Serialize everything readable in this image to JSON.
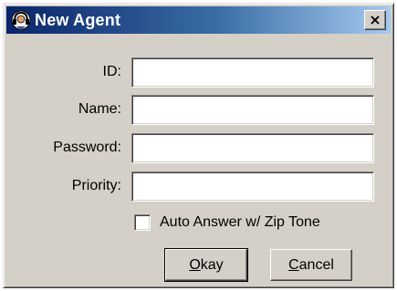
{
  "window": {
    "title": "New Agent",
    "close_glyph": "×",
    "icon": "agent-headset-icon"
  },
  "form": {
    "fields": [
      {
        "label": "ID:",
        "value": ""
      },
      {
        "label": "Name:",
        "value": ""
      },
      {
        "label": "Password:",
        "value": ""
      },
      {
        "label": "Priority:",
        "value": ""
      }
    ],
    "auto_answer": {
      "label": "Auto Answer w/ Zip Tone",
      "checked": false
    }
  },
  "buttons": {
    "okay": {
      "mnemonic": "O",
      "rest": "kay"
    },
    "cancel": {
      "mnemonic": "C",
      "rest": "ancel"
    }
  },
  "colors": {
    "dialog_face": "#d4d0c8",
    "titlebar_start": "#0a246a",
    "titlebar_end": "#a6caf0",
    "title_text": "#ffffff"
  }
}
